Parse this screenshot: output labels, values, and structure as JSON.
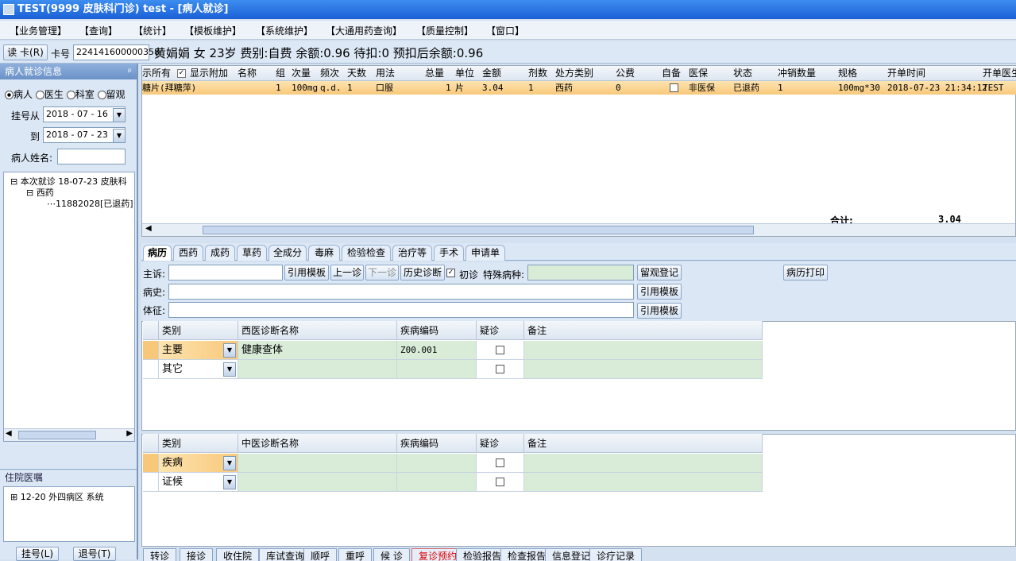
{
  "window": {
    "title": "TEST(9999 皮肤科门诊) test - [病人就诊]"
  },
  "menu": [
    "【业务管理】",
    "【查询】",
    "【统计】",
    "【模板维护】",
    "【系统维护】",
    "【大通用药查询】",
    "【质量控制】",
    "【窗口】"
  ],
  "patient": {
    "read_card": "读 卡(R)",
    "card_label": "卡号",
    "card_no": "224141600000358",
    "info": "黄娟娟 女 23岁 费别:自费 余额:0.96 待扣:0 预扣后余额:0.96"
  },
  "left": {
    "header": "病人就诊信息",
    "pin": "ᵖ",
    "radios": [
      "病人",
      "医生",
      "科室",
      "留观"
    ],
    "reg_from_label": "挂号从",
    "reg_from": "2018 - 07 - 16",
    "to_label": "到",
    "to": "2018 - 07 - 23",
    "name_label": "病人姓名:",
    "tree": {
      "root": "本次就诊 18-07-23 皮肤科",
      "group": "西药",
      "item": "11882028[已退药]"
    },
    "inpatient_header": "住院医嘱",
    "inpatient_item": "12-20 外四病区 系统",
    "btn_reg": "挂号(L)",
    "btn_unreg": "退号(T)"
  },
  "grid": {
    "show_all": "示所有",
    "show_extra": "显示附加",
    "headers": [
      "名称",
      "组",
      "次量",
      "频次",
      "天数",
      "用法",
      "总量",
      "单位",
      "金额",
      "剂数",
      "处方类别",
      "公费",
      "自备",
      "医保",
      "状态",
      "冲销数量",
      "规格",
      "开单时间",
      "开单医生"
    ],
    "row": {
      "name": "糖片(拜糖萍)",
      "group": "1",
      "dose": "100mg",
      "freq": "q.d.",
      "days": "1",
      "usage": "口服",
      "total": "1",
      "unit": "片",
      "amount": "3.04",
      "doses": "1",
      "rx_type": "西药",
      "public": "0",
      "insurance": "非医保",
      "status": "已退药",
      "offset": "1",
      "spec": "100mg*30",
      "time": "2018-07-23 21:34:12",
      "doctor": "TEST"
    },
    "total_label": "合计:",
    "total_value": "3.04"
  },
  "tabs": [
    "病历",
    "西药",
    "成药",
    "草药",
    "全成分",
    "毒麻",
    "检验检查",
    "治疗等",
    "手术",
    "申请单"
  ],
  "form": {
    "chief": "主诉:",
    "btn_template": "引用模板",
    "btn_prev": "上一诊",
    "btn_next": "下一诊",
    "btn_history": "历史诊断",
    "first_visit": "初诊",
    "special": "特殊病种:",
    "btn_observe": "留观登记",
    "btn_print": "病历打印",
    "history": "病史:",
    "sign": "体征:"
  },
  "western": {
    "headers": [
      "类别",
      "西医诊断名称",
      "疾病编码",
      "疑诊",
      "备注"
    ],
    "rows": [
      {
        "type": "主要",
        "name": "健康查体",
        "code": "Z00.001"
      },
      {
        "type": "其它",
        "name": "",
        "code": ""
      }
    ]
  },
  "chinese": {
    "headers": [
      "类别",
      "中医诊断名称",
      "疾病编码",
      "疑诊",
      "备注"
    ],
    "rows": [
      {
        "type": "疾病",
        "name": "",
        "code": ""
      },
      {
        "type": "证候",
        "name": "",
        "code": ""
      }
    ]
  },
  "bottom_tabs": [
    "转诊",
    "接诊",
    "收住院",
    "库试查询",
    "顺呼",
    "重呼",
    "候 诊",
    "复诊预约",
    "检验报告",
    "检查报告",
    "信息登记",
    "诊疗记录"
  ]
}
